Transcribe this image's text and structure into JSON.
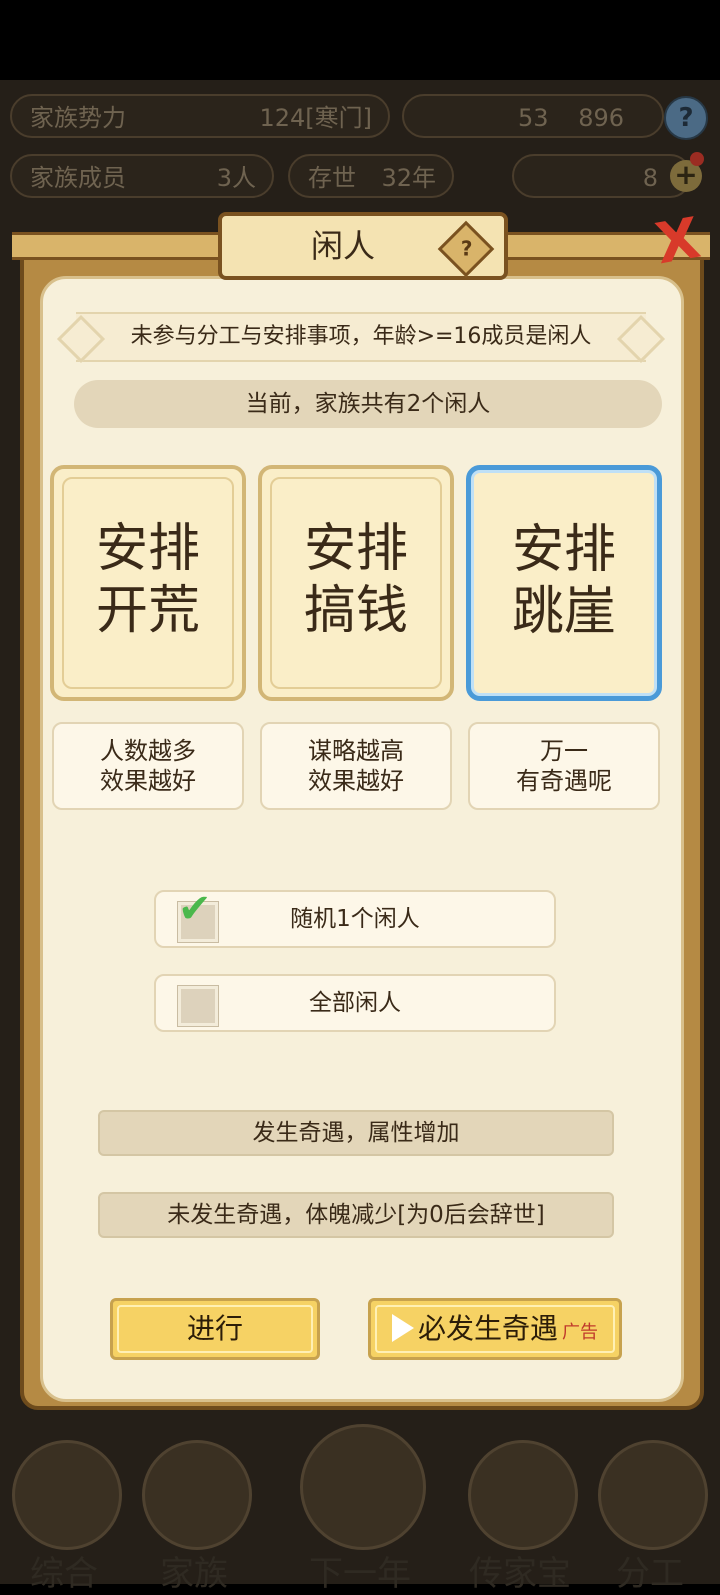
{
  "hud": {
    "family_power_label": "家族势力",
    "family_power_value": "124[寒门]",
    "resource_a": "53",
    "resource_b": "896",
    "members_label": "家族成员",
    "members_value": "3人",
    "exist_label": "存世",
    "exist_value": "32年",
    "gold_value": "8",
    "help": "?",
    "plus": "+"
  },
  "modal": {
    "title": "闲人",
    "title_help": "?",
    "close": "X",
    "rule_text": "未参与分工与安排事项，年龄>=16成员是闲人",
    "count_text": "当前，家族共有2个闲人",
    "cards": [
      {
        "line1": "安排",
        "line2": "开荒",
        "desc1": "人数越多",
        "desc2": "效果越好"
      },
      {
        "line1": "安排",
        "line2": "搞钱",
        "desc1": "谋略越高",
        "desc2": "效果越好"
      },
      {
        "line1": "安排",
        "line2": "跳崖",
        "desc1": "万一",
        "desc2": "有奇遇呢"
      }
    ],
    "selected_card": 2,
    "options": [
      {
        "label": "随机1个闲人",
        "checked": true
      },
      {
        "label": "全部闲人",
        "checked": false
      }
    ],
    "outcomes": [
      "发生奇遇，属性增加",
      "未发生奇遇，体魄减少[为0后会辞世]"
    ],
    "proceed_label": "进行",
    "guarantee_label": "必发生奇遇",
    "ad_label": "广告"
  },
  "bottom_nav": {
    "items": [
      "综合",
      "家族",
      "下一年",
      "传家宝",
      "分工"
    ]
  }
}
